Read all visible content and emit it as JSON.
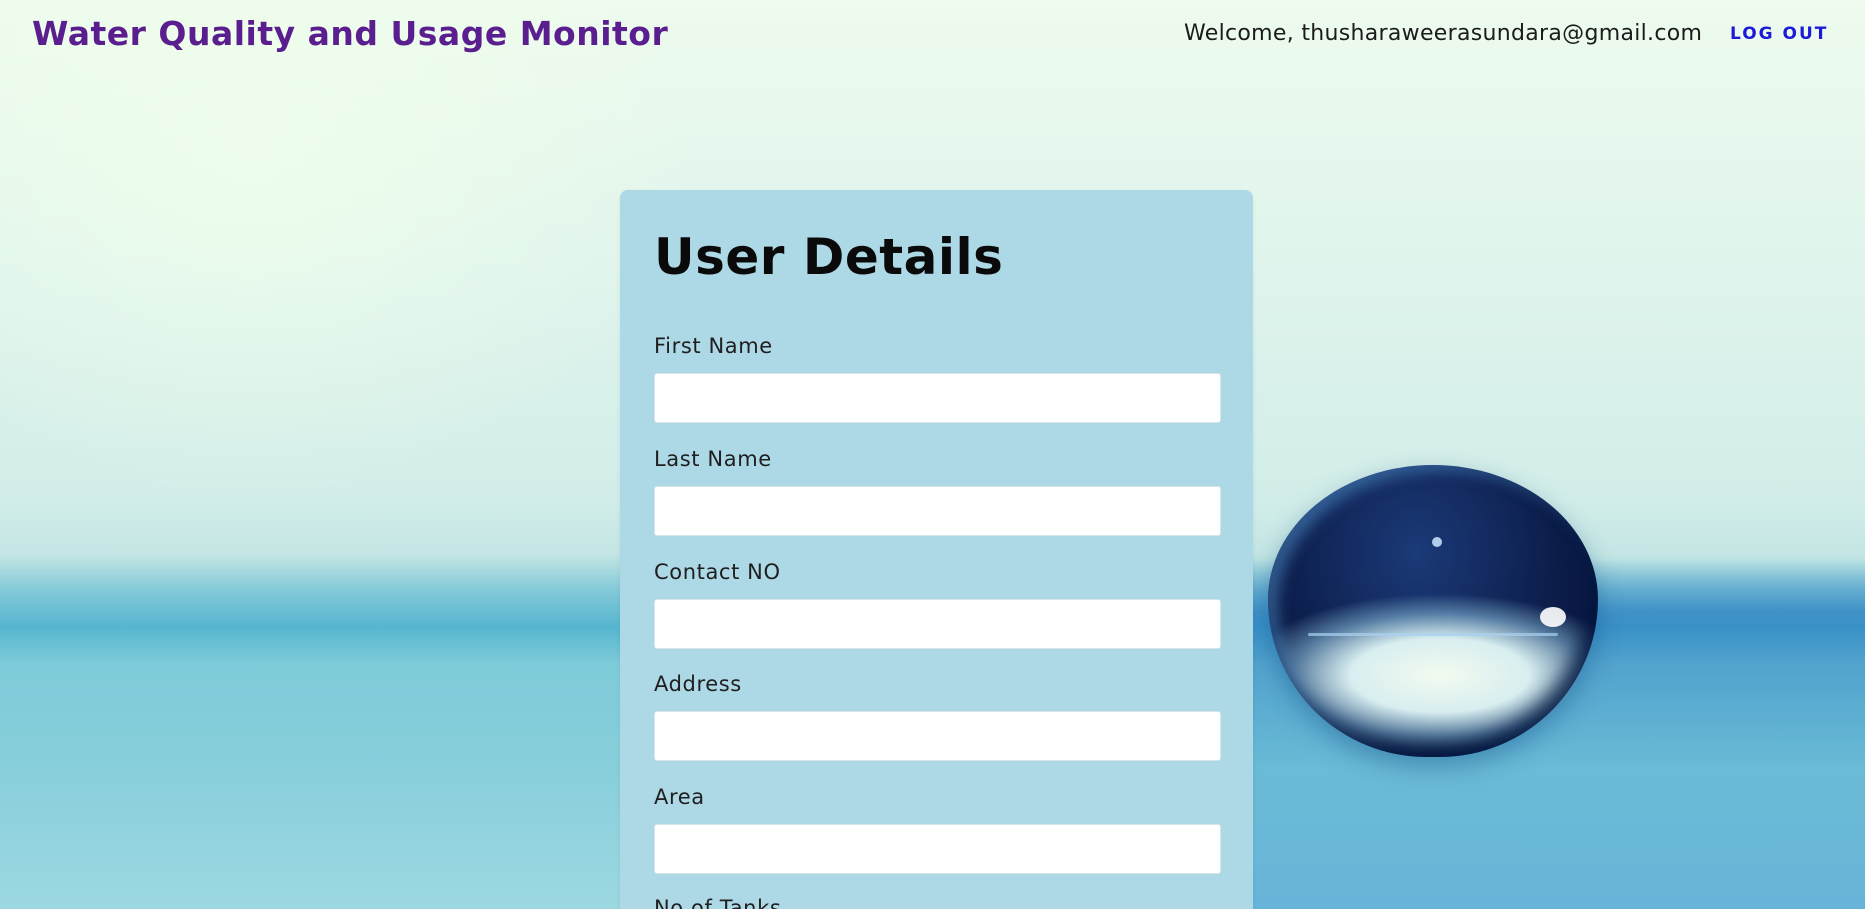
{
  "header": {
    "app_title": "Water Quality and Usage Monitor",
    "welcome_text": "Welcome, thusharaweerasundara@gmail.com",
    "logout_label": "LOG OUT"
  },
  "form": {
    "title": "User Details",
    "fields": [
      {
        "label": "First Name",
        "value": "",
        "placeholder": ""
      },
      {
        "label": "Last Name",
        "value": "",
        "placeholder": ""
      },
      {
        "label": "Contact NO",
        "value": "",
        "placeholder": ""
      },
      {
        "label": "Address",
        "value": "",
        "placeholder": ""
      },
      {
        "label": "Area",
        "value": "",
        "placeholder": ""
      },
      {
        "label": "No of Tanks",
        "value": "",
        "placeholder": ""
      }
    ]
  },
  "colors": {
    "title_purple": "#5a1e8e",
    "logout_blue": "#1a1ad8",
    "card_bg": "#add8e6"
  }
}
